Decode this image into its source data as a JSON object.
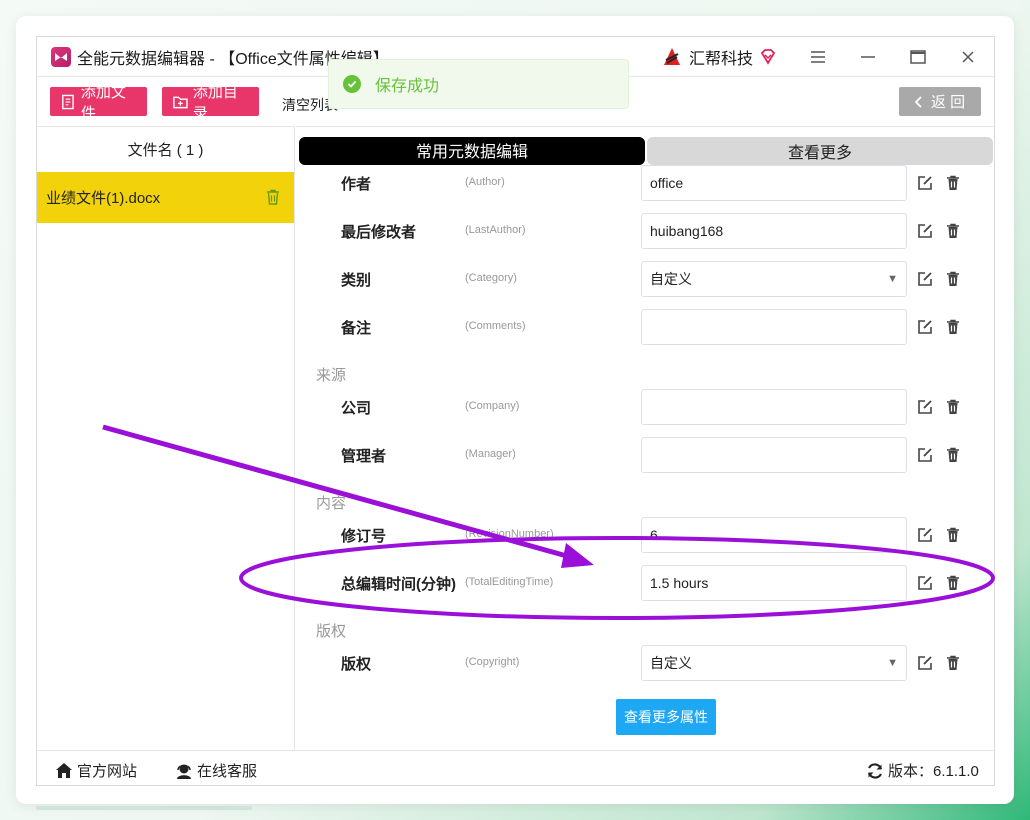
{
  "window": {
    "title": "全能元数据编辑器 - 【Office文件属性编辑】",
    "brand": "汇帮科技"
  },
  "toolbar": {
    "add_file": "添加文件",
    "add_folder": "添加目录",
    "clear_list": "清空列表",
    "back": "返 回"
  },
  "toast": {
    "message": "保存成功"
  },
  "sidebar": {
    "header": "文件名 ( 1 )",
    "files": [
      {
        "name": "业绩文件(1).docx"
      }
    ]
  },
  "tabs": [
    {
      "label": "常用元数据编辑",
      "active": true
    },
    {
      "label": "查看更多",
      "active": false
    }
  ],
  "groups": [
    {
      "title": "来源"
    },
    {
      "title": "内容"
    },
    {
      "title": "版权"
    }
  ],
  "fields": [
    {
      "label": "作者",
      "key": "(Author)",
      "value": "office",
      "type": "text"
    },
    {
      "label": "最后修改者",
      "key": "(LastAuthor)",
      "value": "huibang168",
      "type": "text"
    },
    {
      "label": "类别",
      "key": "(Category)",
      "value": "自定义",
      "type": "select"
    },
    {
      "label": "备注",
      "key": "(Comments)",
      "value": "",
      "type": "text"
    },
    {
      "label": "公司",
      "key": "(Company)",
      "value": "",
      "type": "text"
    },
    {
      "label": "管理者",
      "key": "(Manager)",
      "value": "",
      "type": "text"
    },
    {
      "label": "修订号",
      "key": "(RevisionNumber)",
      "value": "6",
      "type": "text"
    },
    {
      "label": "总编辑时间(分钟)",
      "key": "(TotalEditingTime)",
      "value": "1.5 hours",
      "type": "text"
    },
    {
      "label": "版权",
      "key": "(Copyright)",
      "value": "自定义",
      "type": "select"
    }
  ],
  "more_props_button": "查看更多属性",
  "footer": {
    "website": "官方网站",
    "support": "在线客服",
    "version": "版本：6.1.1.0"
  },
  "colors": {
    "accent_red": "#e8356a",
    "selected_file": "#f2d20a",
    "primary_blue": "#1ea7f2",
    "success_green": "#67c23a",
    "annotation_purple": "#9b10d8"
  }
}
